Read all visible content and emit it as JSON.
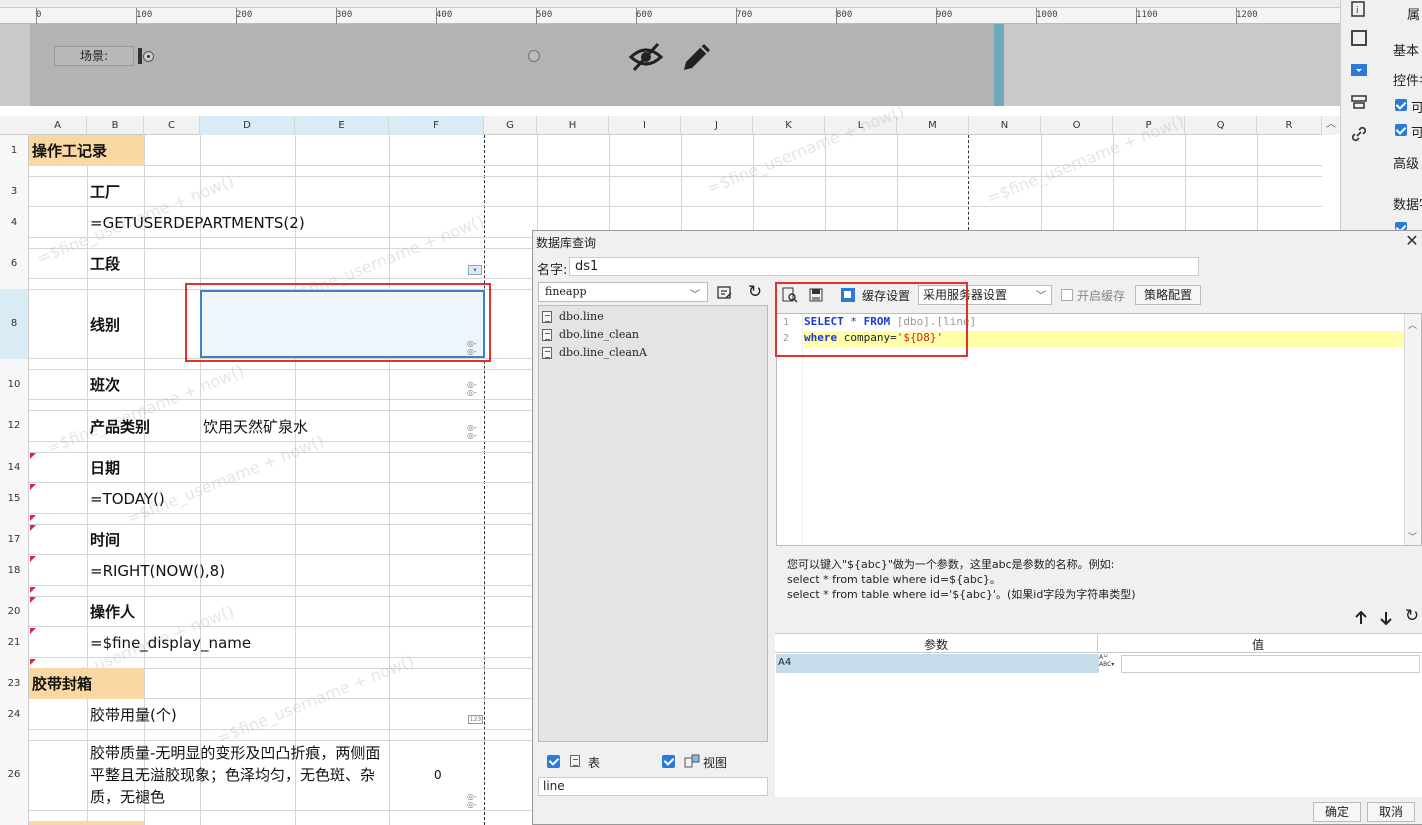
{
  "ruler": {
    "ticks": [
      "0",
      "100",
      "200",
      "300",
      "400",
      "500",
      "600",
      "700",
      "800",
      "900",
      "1000",
      "1100",
      "1200"
    ]
  },
  "param_pane": {
    "scene_label": "场景:"
  },
  "right_panel": {
    "tab_props": "属",
    "basic": "基本",
    "control_name": "控件名",
    "opt1": "可",
    "opt2": "可",
    "advanced": "高级",
    "data_dict": "数据字"
  },
  "grid": {
    "columns": [
      "A",
      "B",
      "C",
      "D",
      "E",
      "F",
      "G",
      "H",
      "I",
      "J",
      "K",
      "L",
      "M",
      "N",
      "O",
      "P",
      "Q",
      "R"
    ],
    "rows": [
      "1",
      "3",
      "4",
      "6",
      "8",
      "10",
      "12",
      "14",
      "15",
      "17",
      "18",
      "20",
      "21",
      "23",
      "24",
      "26"
    ],
    "cells": {
      "r1": "操作工记录",
      "r3": "工厂",
      "r4": "=GETUSERDEPARTMENTS(2)",
      "r6": "工段",
      "r8": "线别",
      "r10": "班次",
      "r12_b": "产品类别",
      "r12_d": "饮用天然矿泉水",
      "r14": "日期",
      "r15": "=TODAY()",
      "r17": "时间",
      "r18": "=RIGHT(NOW(),8)",
      "r20": "操作人",
      "r21": "=$fine_display_name",
      "r23": "胶带封箱",
      "r24": "胶带用量(个)",
      "r26_b": "胶带质量-无明显的变形及凹凸折痕，两侧面平整且无溢胶现象；色泽均匀，无色斑、杂质，无褪色",
      "r26_f": "0"
    },
    "watermark": "=$fine_username + now()"
  },
  "dialog": {
    "title": "数据库查询",
    "close": "✕",
    "name_label": "名字:",
    "name_value": "ds1",
    "connection": "fineapp",
    "tables": [
      "dbo.line",
      "dbo.line_clean",
      "dbo.line_cleanA"
    ],
    "chk_table": "表",
    "chk_view": "视图",
    "search_value": "line",
    "cache_label": "缓存设置",
    "cache_option": "采用服务器设置",
    "open_cache": "开启缓存",
    "policy": "策略配置",
    "sql": {
      "l1_no": "1",
      "l2_no": "2",
      "l1_kw1": "SELECT",
      "l1_star": " * ",
      "l1_kw2": "FROM",
      "l1_obj": " [dbo].[line]",
      "l2_kw": "where",
      "l2_txt": " company=",
      "l2_str": "'${D8}'"
    },
    "hint": "您可以键入\"${abc}\"做为一个参数，这里abc是参数的名称。例如:\nselect * from table where id=${abc}。\nselect * from table where id='${abc}'。(如果id字段为字符串类型)",
    "param_col": "参数",
    "value_col": "值",
    "param_row": "A4",
    "ok": "确定",
    "cancel": "取消"
  },
  "colors": {
    "header_fill": "#f9d8a4",
    "highlight_red": "#e6302b",
    "selection_blue": "#3b82c6"
  }
}
